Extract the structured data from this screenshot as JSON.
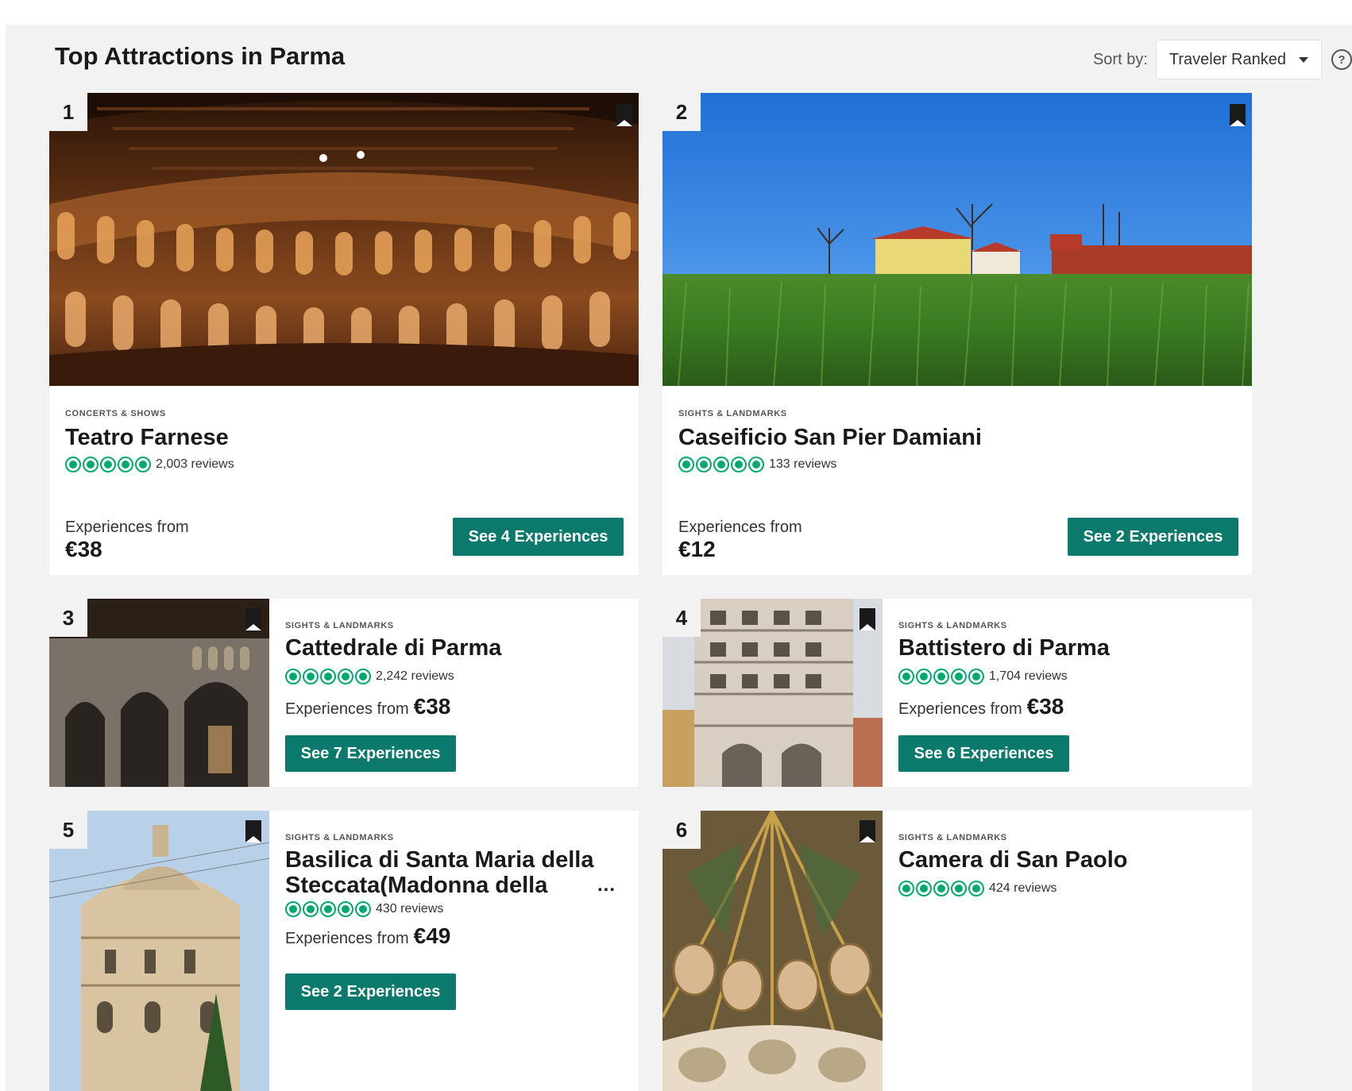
{
  "header": {
    "title": "Top Attractions in Parma",
    "sort_label": "Sort by:",
    "sort_value": "Traveler Ranked",
    "help_glyph": "?"
  },
  "colors": {
    "accent_button": "#0b7a6c",
    "rating_bubble": "#00aa6c",
    "page_bg": "#f2f2f2"
  },
  "attractions": [
    {
      "rank": "1",
      "category": "CONCERTS & SHOWS",
      "name": "Teatro Farnese",
      "reviews": "2,003 reviews",
      "experiences_label": "Experiences from",
      "price": "€38",
      "button": "See 4 Experiences"
    },
    {
      "rank": "2",
      "category": "SIGHTS & LANDMARKS",
      "name": "Caseificio San Pier Damiani",
      "reviews": "133 reviews",
      "experiences_label": "Experiences from",
      "price": "€12",
      "button": "See 2 Experiences"
    },
    {
      "rank": "3",
      "category": "SIGHTS & LANDMARKS",
      "name": "Cattedrale di Parma",
      "reviews": "2,242 reviews",
      "experiences_label": "Experiences from",
      "price": "€38",
      "button": "See 7 Experiences"
    },
    {
      "rank": "4",
      "category": "SIGHTS & LANDMARKS",
      "name": "Battistero di Parma",
      "reviews": "1,704 reviews",
      "experiences_label": "Experiences from",
      "price": "€38",
      "button": "See 6 Experiences"
    },
    {
      "rank": "5",
      "category": "SIGHTS & LANDMARKS",
      "name_line1": "Basilica di Santa Maria della",
      "name_line2": "Steccata(Madonna della",
      "reviews": "430 reviews",
      "experiences_label": "Experiences from",
      "price": "€49",
      "button": "See 2 Experiences",
      "more": "..."
    },
    {
      "rank": "6",
      "category": "SIGHTS & LANDMARKS",
      "name": "Camera di San Paolo",
      "reviews": "424 reviews"
    }
  ]
}
